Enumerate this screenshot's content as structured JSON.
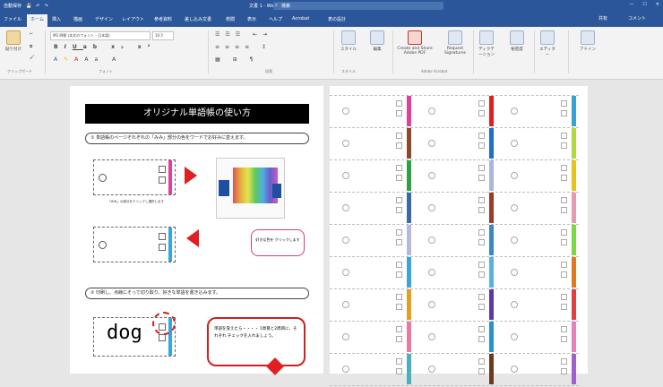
{
  "titlebar": {
    "autosave": "自動保存",
    "doc_title": "文書 1 - Word",
    "search_placeholder": "検索",
    "user": "",
    "controls": [
      "—",
      "☐",
      "✕"
    ]
  },
  "tabs": [
    "ファイル",
    "ホーム",
    "挿入",
    "描画",
    "デザイン",
    "レイアウト",
    "参考資料",
    "差し込み文書",
    "校閲",
    "表示",
    "ヘルプ",
    "Acrobat",
    "表の設計"
  ],
  "active_tab": "ホーム",
  "share_label": "共有",
  "comment_label": "コメント",
  "ribbon": {
    "groups": [
      "クリップボード",
      "フォント",
      "段落",
      "スタイル",
      "編集",
      "Adobe Acrobat",
      "音声",
      "秘密度",
      "エディター",
      "アドイン"
    ],
    "paste_label": "貼り付け",
    "font_name": "MS 明朝 (本文のフォント - 日本語)",
    "font_size": "10.5",
    "styles_label": "スタイル",
    "edit_label": "編集",
    "acrobat_create": "Create and Share Adobe PDF",
    "acrobat_request": "Request Signatures",
    "dictate_label": "ディクテーション",
    "sensitivity_label": "秘密度",
    "editor_label": "エディター",
    "addin_label": "アドイン"
  },
  "page1": {
    "title": "オリジナル単語帳の使い方",
    "step1": "① 単語帳のページそれぞれの「みみ」部分の色をワードでお好みに変えます。",
    "caption1": "「みみ」の部分をクリックし選択します",
    "bubble1": "好きな色を クリックします",
    "step2": "② 印刷し、点線にそって切り取り、好きな単語を書き込みます。",
    "word": "dog",
    "bubble2": "単語を覚えたら・・・・ 1周目と2周目に、それぞれ チェックを入れましょう。"
  },
  "colors": {
    "accent": "#2b579a",
    "strips_left": [
      "#e0409a",
      "#8b4a2b",
      "#2ea043",
      "#3a6aa8",
      "#b7b7e0",
      "#3aa6d8",
      "#e0a020",
      "#e87aa0",
      "#4ab0c0"
    ],
    "strips_mid": [
      "#e02020",
      "#1e6fc8",
      "#a8b8d8",
      "#9a3a28",
      "#3a88c8",
      "#5ab0e0",
      "#5a3aa8",
      "#2a8fd0",
      "#6a3a20"
    ],
    "strips_right": [
      "#3aa0d8",
      "#b0d840",
      "#e8c020",
      "#e89ab0",
      "#7ad840",
      "#e07a20",
      "#e04040",
      "#e880c0",
      "#a060d0"
    ]
  }
}
